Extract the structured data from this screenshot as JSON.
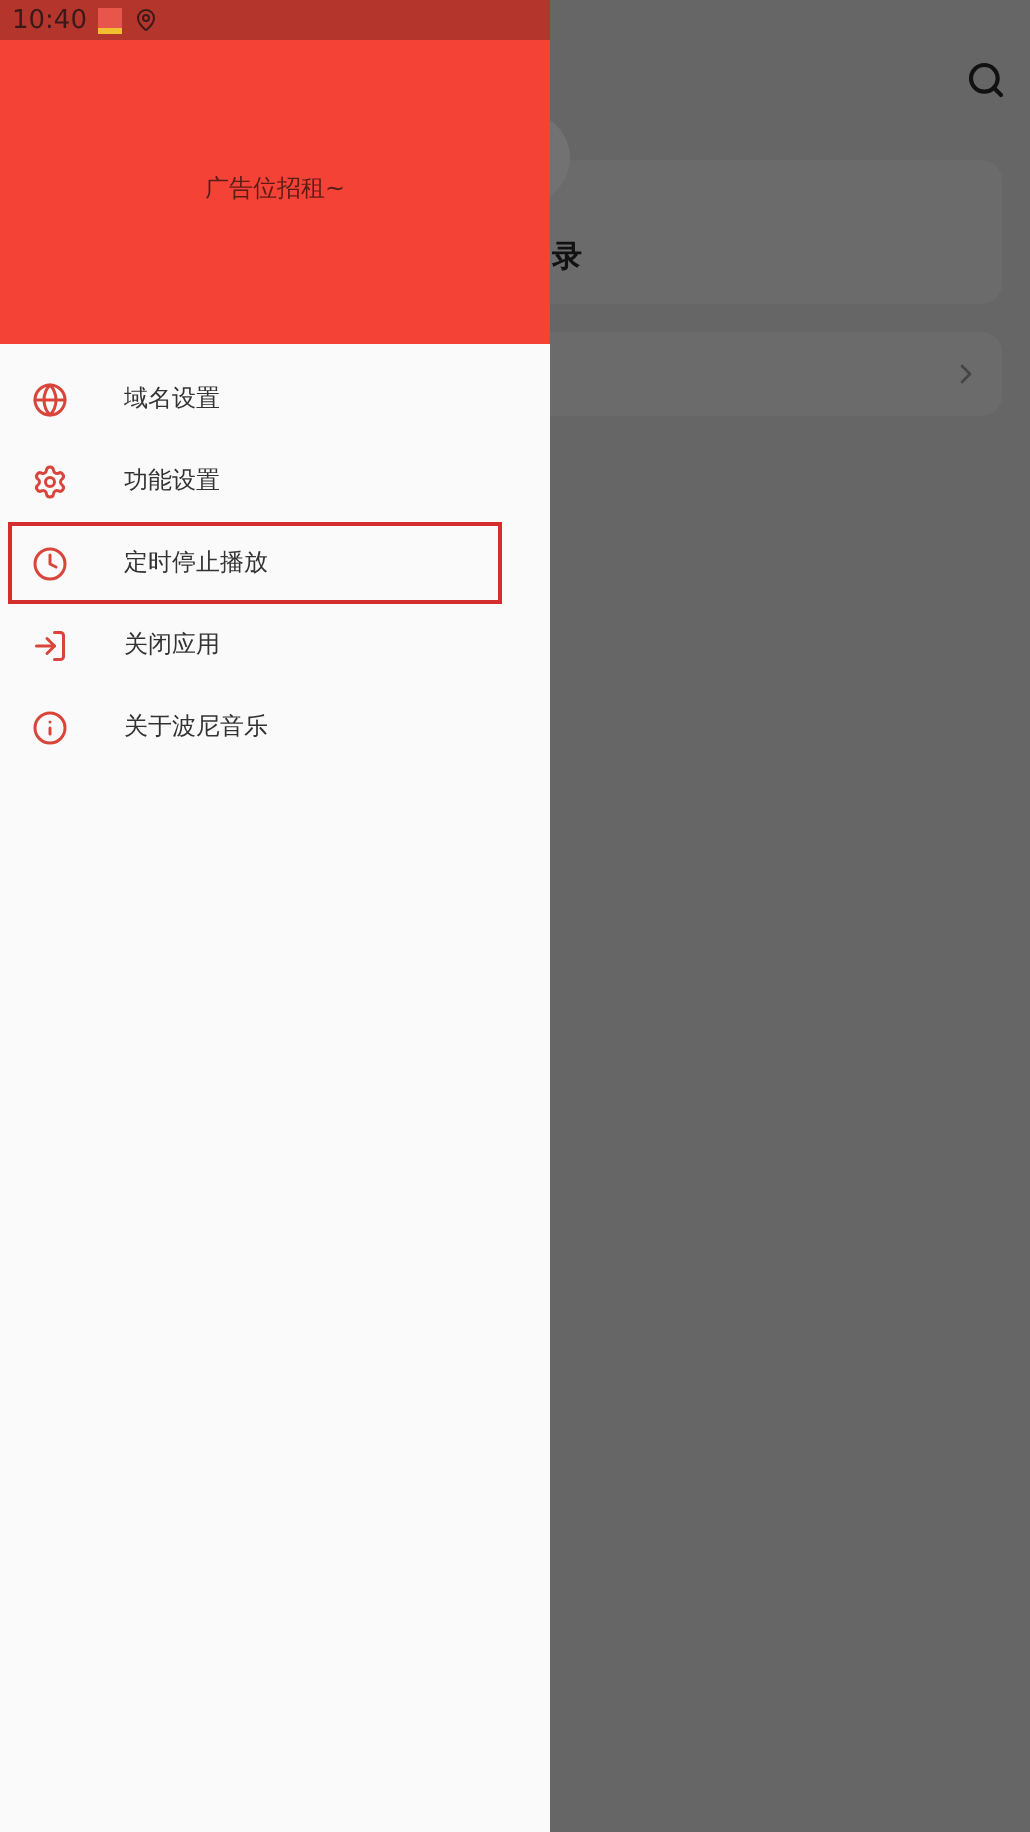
{
  "status_bar": {
    "time": "10:40"
  },
  "drawer": {
    "banner": "广告位招租~",
    "items": [
      {
        "label": "域名设置",
        "highlighted": false
      },
      {
        "label": "功能设置",
        "highlighted": false
      },
      {
        "label": "定时停止播放",
        "highlighted": true
      },
      {
        "label": "关闭应用",
        "highlighted": false
      },
      {
        "label": "关于波尼音乐",
        "highlighted": false
      }
    ]
  },
  "background": {
    "card_title": "录"
  }
}
